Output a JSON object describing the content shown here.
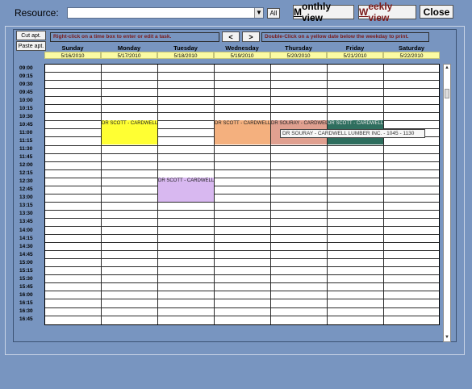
{
  "toolbar": {
    "resource_label": "Resource:",
    "resource_value": "",
    "all_label": "All",
    "monthly_first": "M",
    "monthly_rest": "onthly view",
    "weekly_first": "W",
    "weekly_rest": "eekly view",
    "close_label": "Close"
  },
  "side_buttons": {
    "cut_label": "Cut apt.",
    "paste_label": "Paste apt."
  },
  "hints": {
    "edit_hint": "Right-click on a time box to enter or edit a task.",
    "print_hint": "Double-Click on a yellow date below the weekday to print.",
    "prev_label": "<",
    "next_label": ">"
  },
  "days": [
    {
      "name": "Sunday",
      "date": "5/16/2010"
    },
    {
      "name": "Monday",
      "date": "5/17/2010"
    },
    {
      "name": "Tuesday",
      "date": "5/18/2010"
    },
    {
      "name": "Wednesday",
      "date": "5/19/2010"
    },
    {
      "name": "Thursday",
      "date": "5/20/2010"
    },
    {
      "name": "Friday",
      "date": "5/21/2010"
    },
    {
      "name": "Saturday",
      "date": "5/22/2010"
    }
  ],
  "times": [
    "09:00",
    "09:15",
    "09:30",
    "09:45",
    "10:00",
    "10:15",
    "10:30",
    "10:45",
    "11:00",
    "11:15",
    "11:30",
    "11:45",
    "12:00",
    "12:15",
    "12:30",
    "12:45",
    "13:00",
    "13:15",
    "13:30",
    "13:45",
    "14:00",
    "14:15",
    "14:30",
    "14:45",
    "15:00",
    "15:15",
    "15:30",
    "15:45",
    "16:00",
    "16:15",
    "16:30",
    "16:45"
  ],
  "appointments": [
    {
      "label": "DR SCOTT - CARDWELL",
      "day": 1,
      "start": 7,
      "slots": 3,
      "color": "#ffff33"
    },
    {
      "label": "DR SCOTT - CARDWELL",
      "day": 2,
      "start": 14,
      "slots": 3,
      "color": "#d8b8f0"
    },
    {
      "label": "DR SCOTT - CARDWELL",
      "day": 3,
      "start": 7,
      "slots": 3,
      "color": "#f4b07e"
    },
    {
      "label": "DR SOURAY - CARDWELL",
      "day": 4,
      "start": 7,
      "slots": 3,
      "color": "#e0a090"
    },
    {
      "label": "DR SCOTT - CARDWELL",
      "day": 5,
      "start": 7,
      "slots": 3,
      "color": "#2e6e5e"
    }
  ],
  "tooltip": "DR SOURAY - CARDWELL LUMBER INC. - 1045 - 1130",
  "scrollbar": {
    "up": "▲",
    "down": "▼"
  }
}
